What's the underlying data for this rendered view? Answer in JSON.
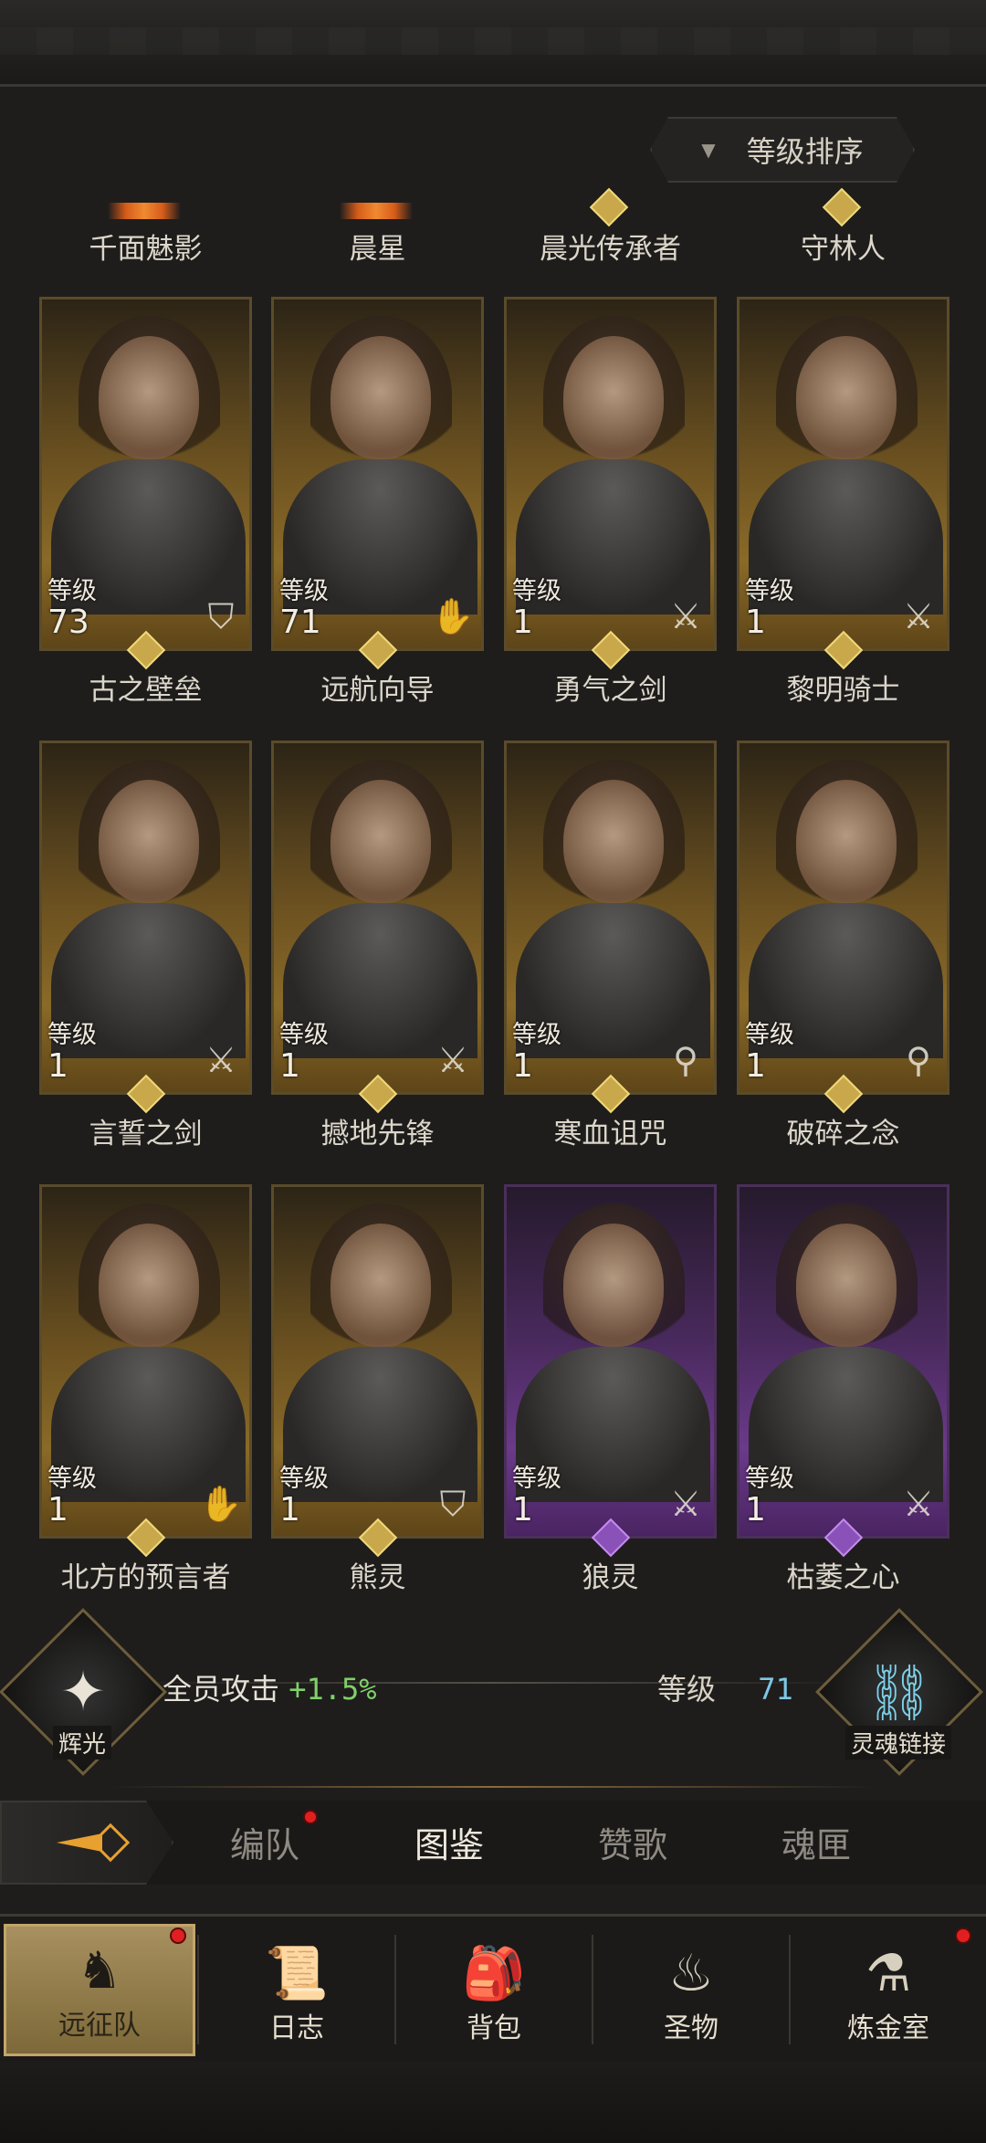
{
  "sort_button": {
    "label": "等级排序"
  },
  "top_names": [
    "千面魅影",
    "晨星",
    "晨光传承者",
    "守林人"
  ],
  "level_label": "等级",
  "cards": [
    {
      "name": "古之壁垒",
      "level": "73",
      "class_icon": "shield-icon",
      "rarity": "gold"
    },
    {
      "name": "远航向导",
      "level": "71",
      "class_icon": "palm-icon",
      "rarity": "gold"
    },
    {
      "name": "勇气之剑",
      "level": "1",
      "class_icon": "sword-icon",
      "rarity": "gold"
    },
    {
      "name": "黎明骑士",
      "level": "1",
      "class_icon": "sword-icon",
      "rarity": "gold"
    },
    {
      "name": "言誓之剑",
      "level": "1",
      "class_icon": "sword-icon",
      "rarity": "gold"
    },
    {
      "name": "撼地先锋",
      "level": "1",
      "class_icon": "sword-icon",
      "rarity": "gold"
    },
    {
      "name": "寒血诅咒",
      "level": "1",
      "class_icon": "staff-icon",
      "rarity": "gold"
    },
    {
      "name": "破碎之念",
      "level": "1",
      "class_icon": "staff-icon",
      "rarity": "gold"
    },
    {
      "name": "北方的预言者",
      "level": "1",
      "class_icon": "palm-icon",
      "rarity": "gold"
    },
    {
      "name": "熊灵",
      "level": "1",
      "class_icon": "shield-icon",
      "rarity": "gold"
    },
    {
      "name": "狼灵",
      "level": "1",
      "class_icon": "sword-icon",
      "rarity": "purple"
    },
    {
      "name": "枯萎之心",
      "level": "1",
      "class_icon": "sword-icon",
      "rarity": "purple"
    }
  ],
  "bonus": {
    "left_emblem_label": "辉光",
    "attack_label": "全员攻击",
    "attack_value": "+1.5%",
    "level_label": "等级",
    "level_value": "71",
    "right_emblem_label": "灵魂链接"
  },
  "tabs": [
    "编队",
    "图鉴",
    "赞歌",
    "魂匣"
  ],
  "active_tab": "图鉴",
  "bottom_nav": [
    "远征队",
    "日志",
    "背包",
    "圣物",
    "炼金室"
  ],
  "colors": {
    "gold_rarity": "#8a6a28",
    "purple_rarity": "#6b3a8a",
    "attack_value": "#7fd06a",
    "level_value": "#7ec8e6",
    "notification_dot": "#e02020"
  }
}
